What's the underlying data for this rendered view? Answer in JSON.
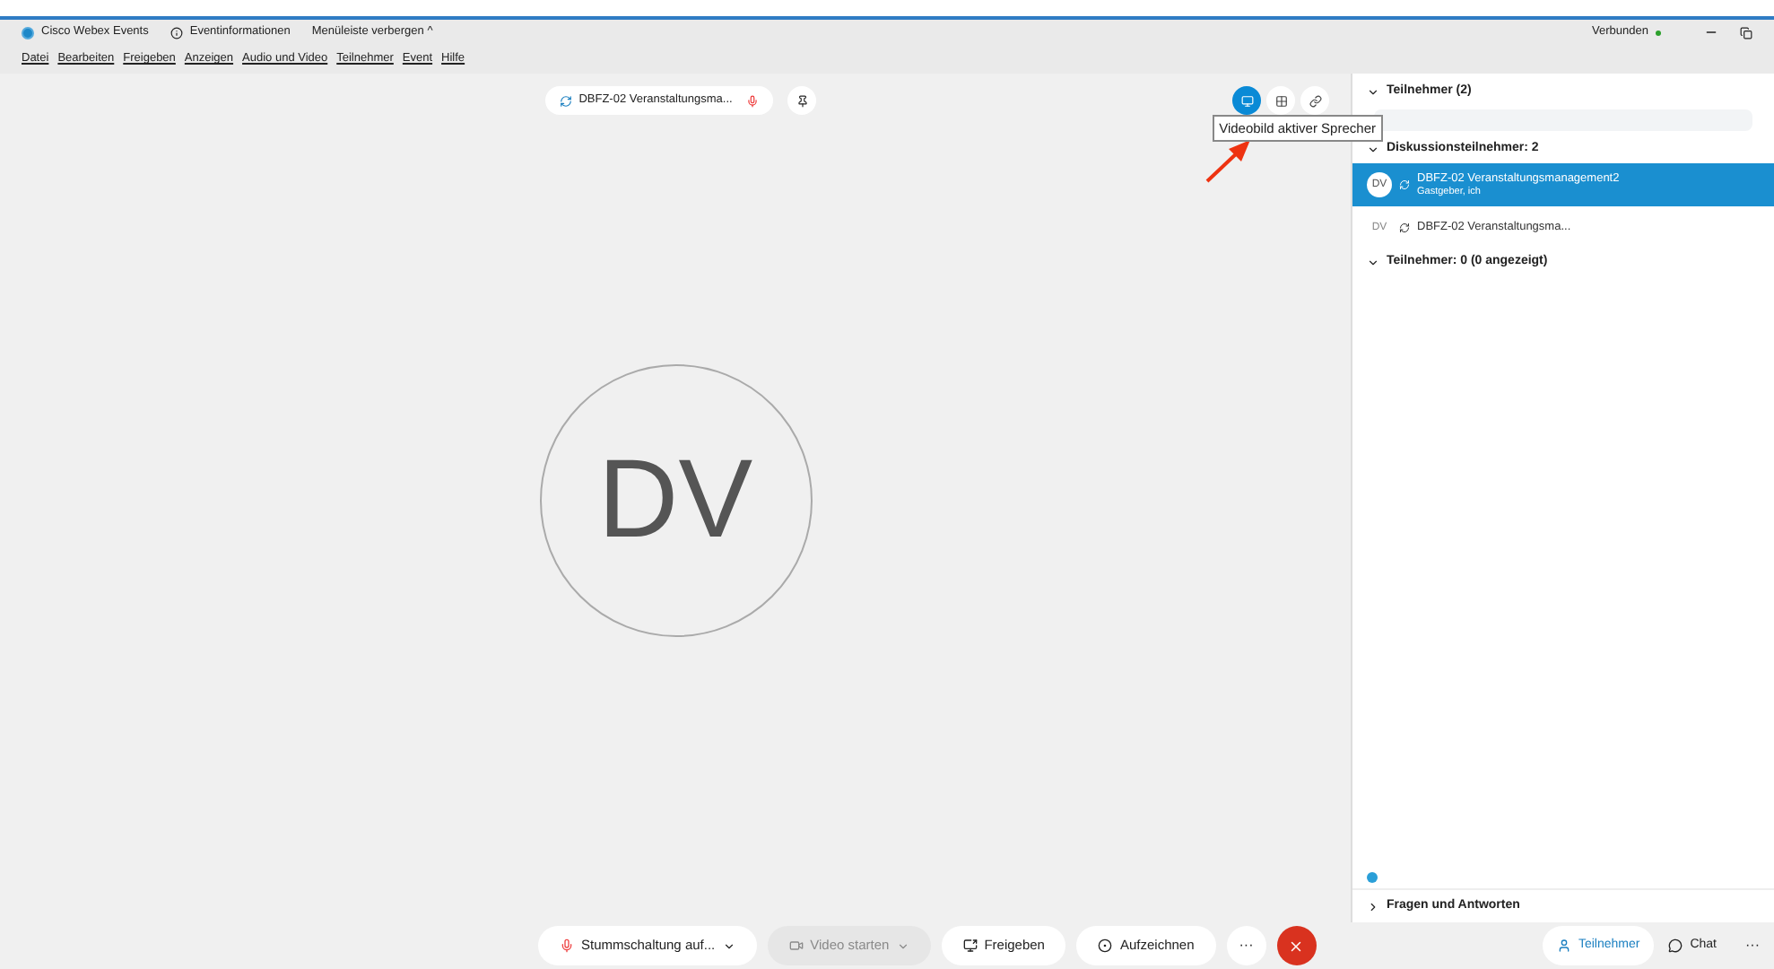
{
  "title_bar": {
    "app_name": "Cisco Webex Events",
    "event_info": "Eventinformationen",
    "hide_menu": "Menüleiste verbergen ^",
    "status": "Verbunden",
    "connected": true
  },
  "menu": [
    {
      "label": "Datei"
    },
    {
      "label": "Bearbeiten"
    },
    {
      "label": "Freigeben"
    },
    {
      "label": "Anzeigen"
    },
    {
      "label": "Audio und Video"
    },
    {
      "label": "Teilnehmer"
    },
    {
      "label": "Event"
    },
    {
      "label": "Hilfe"
    }
  ],
  "stage": {
    "speaker_label": "DBFZ-02 Veranstaltungsma...",
    "avatar_initials": "DV",
    "layouts": [
      {
        "kind": "active",
        "selected": true
      },
      {
        "kind": "grid",
        "selected": false
      },
      {
        "kind": "link",
        "selected": false
      }
    ],
    "tooltip": "Videobild aktiver Sprecher"
  },
  "panel": {
    "header": "Teilnehmer (2)",
    "groups": [
      {
        "label": "Diskussionsteilnehmer: 2",
        "expanded": true,
        "members": [
          {
            "initials": "DV",
            "name": "DBFZ-02 Veranstaltungsmanagement2",
            "role": "Gastgeber, ich",
            "selected": true
          },
          {
            "initials": "DV",
            "name": "DBFZ-02 Veranstaltungsma...",
            "selected": false
          }
        ]
      },
      {
        "label": "Teilnehmer: 0 (0 angezeigt)",
        "expanded": true
      }
    ],
    "qa": "Fragen und Antworten"
  },
  "controls": [
    {
      "kind": "mute",
      "label": "Stummschaltung auf...",
      "disabled": false,
      "caret": true
    },
    {
      "kind": "video",
      "label": "Video starten",
      "disabled": true,
      "caret": true
    },
    {
      "kind": "share",
      "label": "Freigeben",
      "disabled": false,
      "caret": false
    },
    {
      "kind": "record",
      "label": "Aufzeichnen",
      "disabled": false,
      "caret": false
    }
  ],
  "more": "···",
  "side_tabs": [
    {
      "label": "Teilnehmer",
      "selected": true
    },
    {
      "label": "Chat",
      "selected": false
    }
  ],
  "side_more": "···"
}
